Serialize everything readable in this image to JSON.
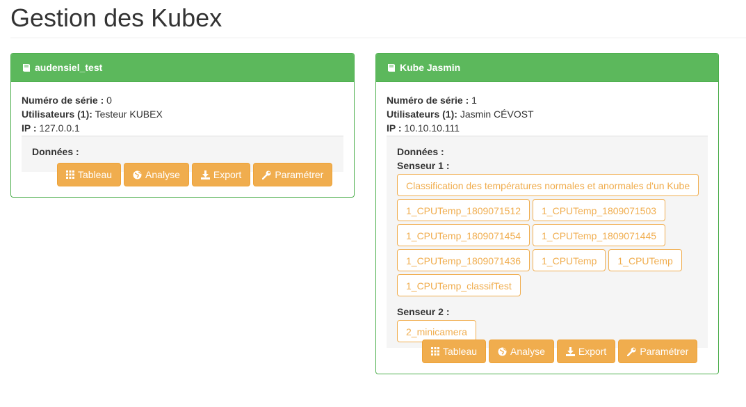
{
  "page": {
    "title": "Gestion des Kubex"
  },
  "kubes": [
    {
      "name": "audensiel_test",
      "serial_label": "Numéro de série :",
      "serial": "0",
      "users_label": "Utilisateurs (1):",
      "users": "Testeur KUBEX",
      "ip_label": "IP :",
      "ip": "127.0.0.1",
      "data_label": "Données :",
      "buttons": [
        "Tableau",
        "Analyse",
        "Export",
        "Paramétrer"
      ]
    },
    {
      "name": "Kube Jasmin",
      "serial_label": "Numéro de série :",
      "serial": "1",
      "users_label": "Utilisateurs (1):",
      "users": "Jasmin CÉVOST",
      "ip_label": "IP :",
      "ip": "10.10.10.111",
      "data_label": "Données :",
      "sensors": [
        {
          "label": "Senseur 1 :",
          "datasets": [
            "Classification des températures normales et anormales d'un Kube",
            "1_CPUTemp_1809071512",
            "1_CPUTemp_1809071503",
            "1_CPUTemp_1809071454",
            "1_CPUTemp_1809071445",
            "1_CPUTemp_1809071436",
            "1_CPUTemp",
            "1_CPUTemp",
            "1_CPUTemp_classifTest"
          ]
        },
        {
          "label": "Senseur 2 :",
          "datasets": [
            "2_minicamera"
          ]
        }
      ],
      "buttons": [
        "Tableau",
        "Analyse",
        "Export",
        "Paramétrer"
      ]
    }
  ],
  "icons": {
    "panel": "book-icon",
    "tableau": "grid-icon",
    "analyse": "globe-icon",
    "export": "download-icon",
    "parametrer": "wrench-icon"
  },
  "colors": {
    "success": "#5cb85c",
    "warning": "#f0ad4e"
  }
}
